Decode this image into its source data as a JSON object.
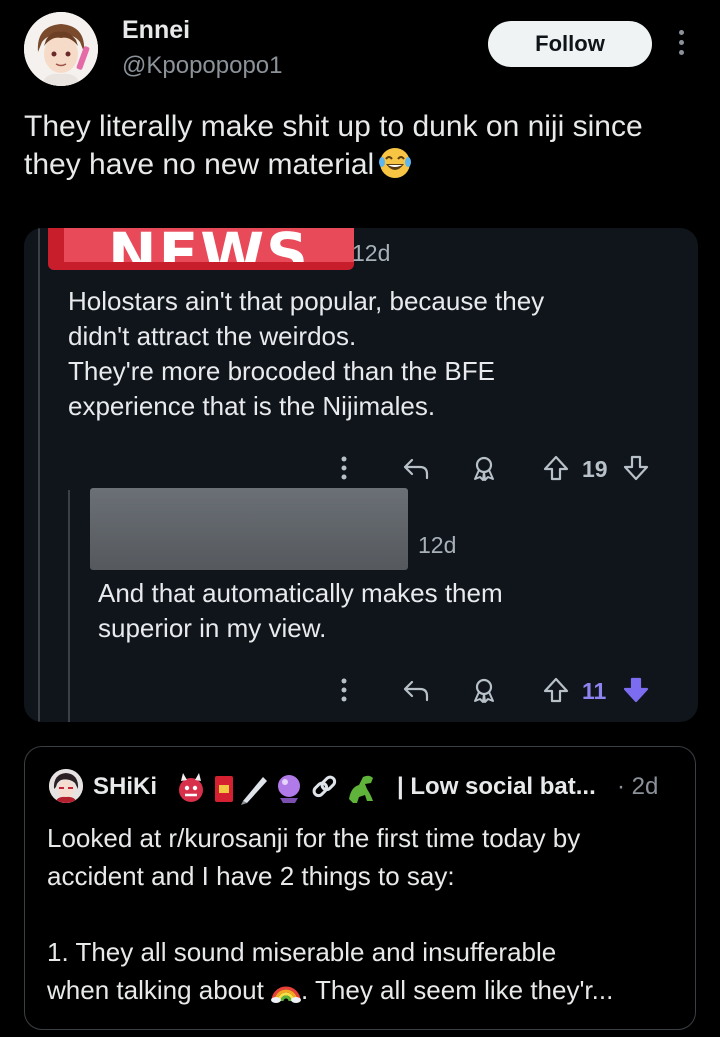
{
  "author": {
    "display_name": "Ennei",
    "handle": "@Kpopopopo1",
    "follow_label": "Follow"
  },
  "tweet": {
    "text": "They literally make shit up to dunk on niji since they have no new material"
  },
  "reddit": {
    "banner_text": "NEWS",
    "comment1": {
      "time": "12d",
      "lines": [
        "Holostars ain't that popular, because they",
        "didn't attract the weirdos.",
        "They're more brocoded than the BFE",
        "experience that is the Nijimales."
      ],
      "votes": "19"
    },
    "comment2": {
      "time": "12d",
      "lines": [
        "And that automatically makes them",
        "superior in my view."
      ],
      "votes": "11"
    }
  },
  "quote": {
    "name": "SHiKi",
    "name_suffix": "| Low social bat...",
    "time": "· 2d",
    "text_part1": "Looked at r/kurosanji for the first time today by\naccident and I have 2 things to say:\n\n1. They all sound miserable and insufferable\nwhen talking about ",
    "text_part2": ". They all seem like they'r..."
  },
  "colors": {
    "background": "#000000",
    "upvote_active": "#8e84f0",
    "downvote_active": "#7b6cf0",
    "follow_bg": "#eff3f4"
  }
}
